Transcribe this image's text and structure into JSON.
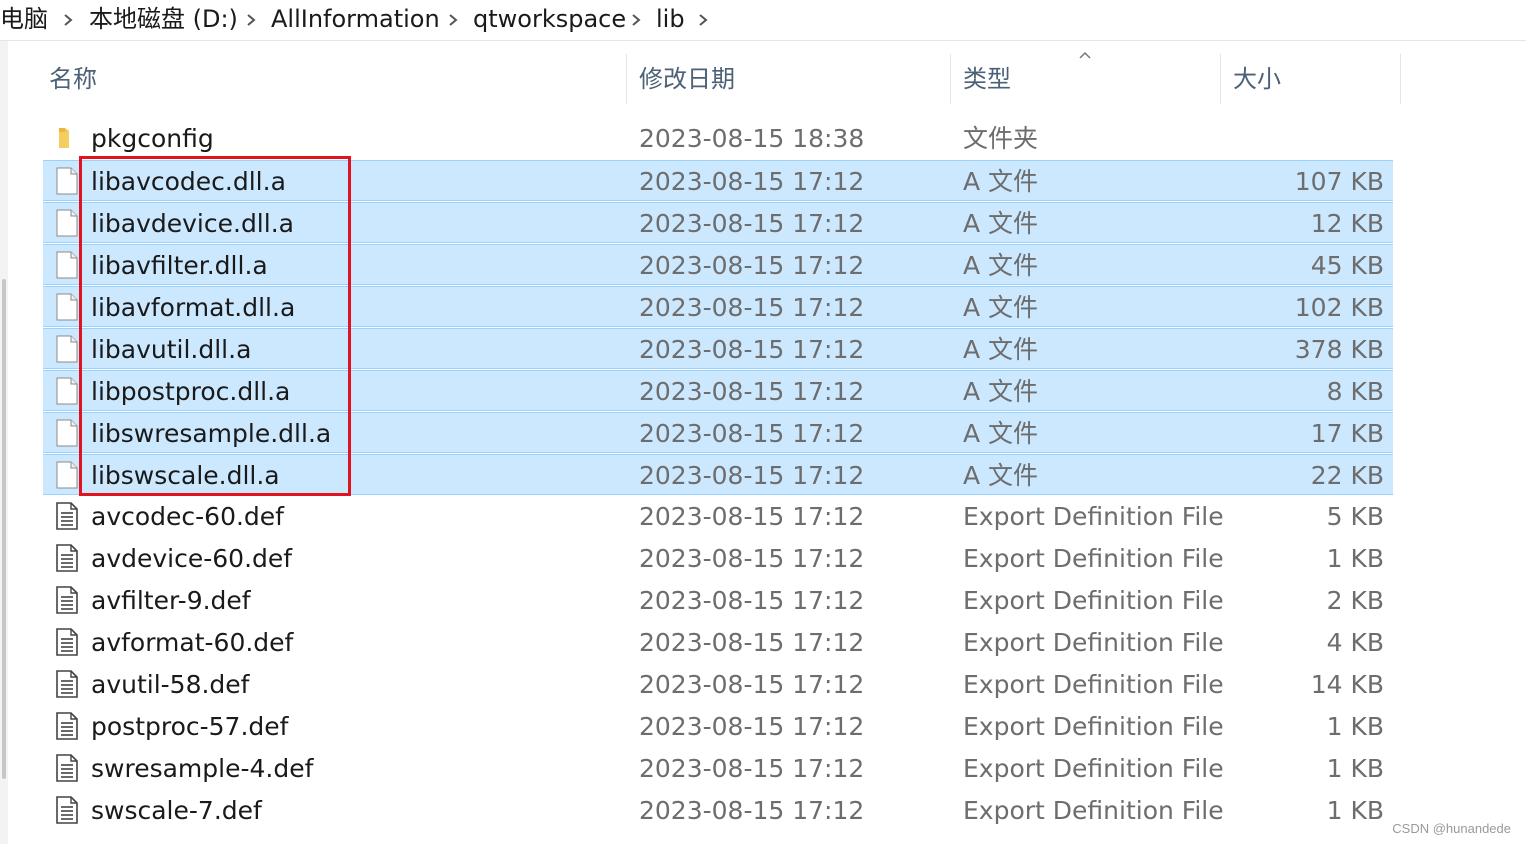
{
  "breadcrumb": {
    "items": [
      {
        "label": "此电脑"
      },
      {
        "label": "本地磁盘 (D:)"
      },
      {
        "label": "AllInformation"
      },
      {
        "label": "qtworkspace"
      },
      {
        "label": "lib"
      }
    ]
  },
  "columns": {
    "name": "名称",
    "date": "修改日期",
    "type": "类型",
    "size": "大小",
    "sort_indicator": "sort-ascending-icon"
  },
  "files": [
    {
      "name": "pkgconfig",
      "date": "2023-08-15 18:38",
      "type": "文件夹",
      "size": "",
      "icon": "folder-icon",
      "selected": false
    },
    {
      "name": "libavcodec.dll.a",
      "date": "2023-08-15 17:12",
      "type": "A 文件",
      "size": "107 KB",
      "icon": "file-icon",
      "selected": true
    },
    {
      "name": "libavdevice.dll.a",
      "date": "2023-08-15 17:12",
      "type": "A 文件",
      "size": "12 KB",
      "icon": "file-icon",
      "selected": true
    },
    {
      "name": "libavfilter.dll.a",
      "date": "2023-08-15 17:12",
      "type": "A 文件",
      "size": "45 KB",
      "icon": "file-icon",
      "selected": true
    },
    {
      "name": "libavformat.dll.a",
      "date": "2023-08-15 17:12",
      "type": "A 文件",
      "size": "102 KB",
      "icon": "file-icon",
      "selected": true
    },
    {
      "name": "libavutil.dll.a",
      "date": "2023-08-15 17:12",
      "type": "A 文件",
      "size": "378 KB",
      "icon": "file-icon",
      "selected": true
    },
    {
      "name": "libpostproc.dll.a",
      "date": "2023-08-15 17:12",
      "type": "A 文件",
      "size": "8 KB",
      "icon": "file-icon",
      "selected": true
    },
    {
      "name": "libswresample.dll.a",
      "date": "2023-08-15 17:12",
      "type": "A 文件",
      "size": "17 KB",
      "icon": "file-icon",
      "selected": true
    },
    {
      "name": "libswscale.dll.a",
      "date": "2023-08-15 17:12",
      "type": "A 文件",
      "size": "22 KB",
      "icon": "file-icon",
      "selected": true
    },
    {
      "name": "avcodec-60.def",
      "date": "2023-08-15 17:12",
      "type": "Export Definition File",
      "size": "5 KB",
      "icon": "text-document-icon",
      "selected": false
    },
    {
      "name": "avdevice-60.def",
      "date": "2023-08-15 17:12",
      "type": "Export Definition File",
      "size": "1 KB",
      "icon": "text-document-icon",
      "selected": false
    },
    {
      "name": "avfilter-9.def",
      "date": "2023-08-15 17:12",
      "type": "Export Definition File",
      "size": "2 KB",
      "icon": "text-document-icon",
      "selected": false
    },
    {
      "name": "avformat-60.def",
      "date": "2023-08-15 17:12",
      "type": "Export Definition File",
      "size": "4 KB",
      "icon": "text-document-icon",
      "selected": false
    },
    {
      "name": "avutil-58.def",
      "date": "2023-08-15 17:12",
      "type": "Export Definition File",
      "size": "14 KB",
      "icon": "text-document-icon",
      "selected": false
    },
    {
      "name": "postproc-57.def",
      "date": "2023-08-15 17:12",
      "type": "Export Definition File",
      "size": "1 KB",
      "icon": "text-document-icon",
      "selected": false
    },
    {
      "name": "swresample-4.def",
      "date": "2023-08-15 17:12",
      "type": "Export Definition File",
      "size": "1 KB",
      "icon": "text-document-icon",
      "selected": false
    },
    {
      "name": "swscale-7.def",
      "date": "2023-08-15 17:12",
      "type": "Export Definition File",
      "size": "1 KB",
      "icon": "text-document-icon",
      "selected": false
    }
  ],
  "colors": {
    "selection_bg": "#cce8ff",
    "selection_border": "#99d1ff",
    "annotation": "#e0131f",
    "header_text": "#4c6077",
    "secondary_text": "#6d6d6d"
  },
  "watermark": "CSDN @hunandede"
}
